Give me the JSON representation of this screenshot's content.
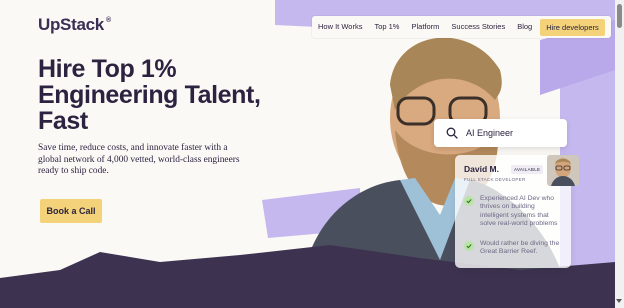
{
  "logo": {
    "text": "UpStack",
    "mark": "®"
  },
  "nav": {
    "items": [
      "How It Works",
      "Top 1%",
      "Platform",
      "Success Stories",
      "Blog"
    ],
    "cta": "Hire developers"
  },
  "hero": {
    "title": "Hire Top 1% Engineering Talent, Fast",
    "subtitle": "Save time, reduce costs, and innovate faster with a global network of 4,000 vetted, world-class engineers ready to ship code.",
    "cta": "Book a Call"
  },
  "search": {
    "value": "AI Engineer",
    "icon": "search-icon"
  },
  "profile": {
    "name": "David M.",
    "badge": "AVAILABLE",
    "role": "FULL STACK DEVELOPER",
    "features": [
      "Experienced AI Dev who thrives on building intelligent systems that solve real-world problems",
      "Would rather be diving the Great Barrier Reef."
    ]
  },
  "colors": {
    "accent": "#f3d27a",
    "lavender": "#c5b8ef",
    "dark": "#3d3350",
    "text": "#2b2340",
    "background": "#fbf9f5"
  }
}
